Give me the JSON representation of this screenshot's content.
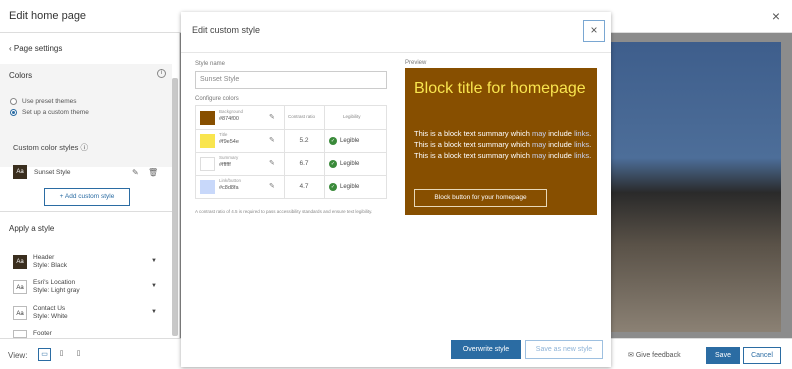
{
  "app": {
    "title": "Edit home page",
    "close_icon": "×"
  },
  "sidebar": {
    "back_label": "Page settings",
    "colors_title": "Colors",
    "info_icon": "i",
    "radio_preset": "Use preset themes",
    "radio_custom": "Set up a custom theme",
    "custom_styles_title": "Custom color styles ⓘ",
    "custom_style_name": "Sunset Style",
    "add_custom_style": "+ Add custom style",
    "apply_title": "Apply a style",
    "apply_items": [
      {
        "aa": "Aa",
        "name": "Header",
        "style": "Style: Black"
      },
      {
        "aa": "Aa",
        "name": "Esri's Location",
        "style": "Style: Light gray"
      },
      {
        "aa": "Aa",
        "name": "Contact Us",
        "style": "Style: White"
      },
      {
        "aa": "Aa",
        "name": "Footer",
        "style": ""
      }
    ]
  },
  "bottom_bar": {
    "view_label": "View:",
    "give_feedback": "Give feedback",
    "save": "Save",
    "cancel": "Cancel"
  },
  "modal": {
    "title": "Edit custom style",
    "close_icon": "×",
    "style_name_label": "Style name",
    "style_name_value": "Sunset Style",
    "configure_colors_label": "Configure colors",
    "contrast_header": "Contrast ratio",
    "legibility_header": "Legibility",
    "colors": [
      {
        "label": "Background",
        "value": "#874f00",
        "swatch": "#874f00",
        "ratio": "",
        "legibility": ""
      },
      {
        "label": "Title",
        "value": "#f9e54e",
        "swatch": "#f9e54e",
        "ratio": "5.2",
        "legibility": "Legible"
      },
      {
        "label": "Summary",
        "value": "#ffffff",
        "swatch": "#ffffff",
        "ratio": "6.7",
        "legibility": "Legible"
      },
      {
        "label": "Link/button",
        "value": "#c8d8fa",
        "swatch": "#c8d8fa",
        "ratio": "4.7",
        "legibility": "Legible"
      }
    ],
    "footnote": "A contrast ratio of 4.5 is required to pass accessibility standards and ensure text legibility.",
    "preview_label": "Preview",
    "preview": {
      "title": "Block title for homepage",
      "text_parts": [
        "This is a block text summary which ",
        "may",
        " include ",
        "links",
        ". This is a block text summary which ",
        "may",
        " include ",
        "links",
        ". This is a block text summary which ",
        "may",
        " include ",
        "links",
        "."
      ],
      "button": "Block button for your homepage"
    },
    "overwrite_btn": "Overwrite style",
    "save_as_new_btn": "Save as new style"
  }
}
